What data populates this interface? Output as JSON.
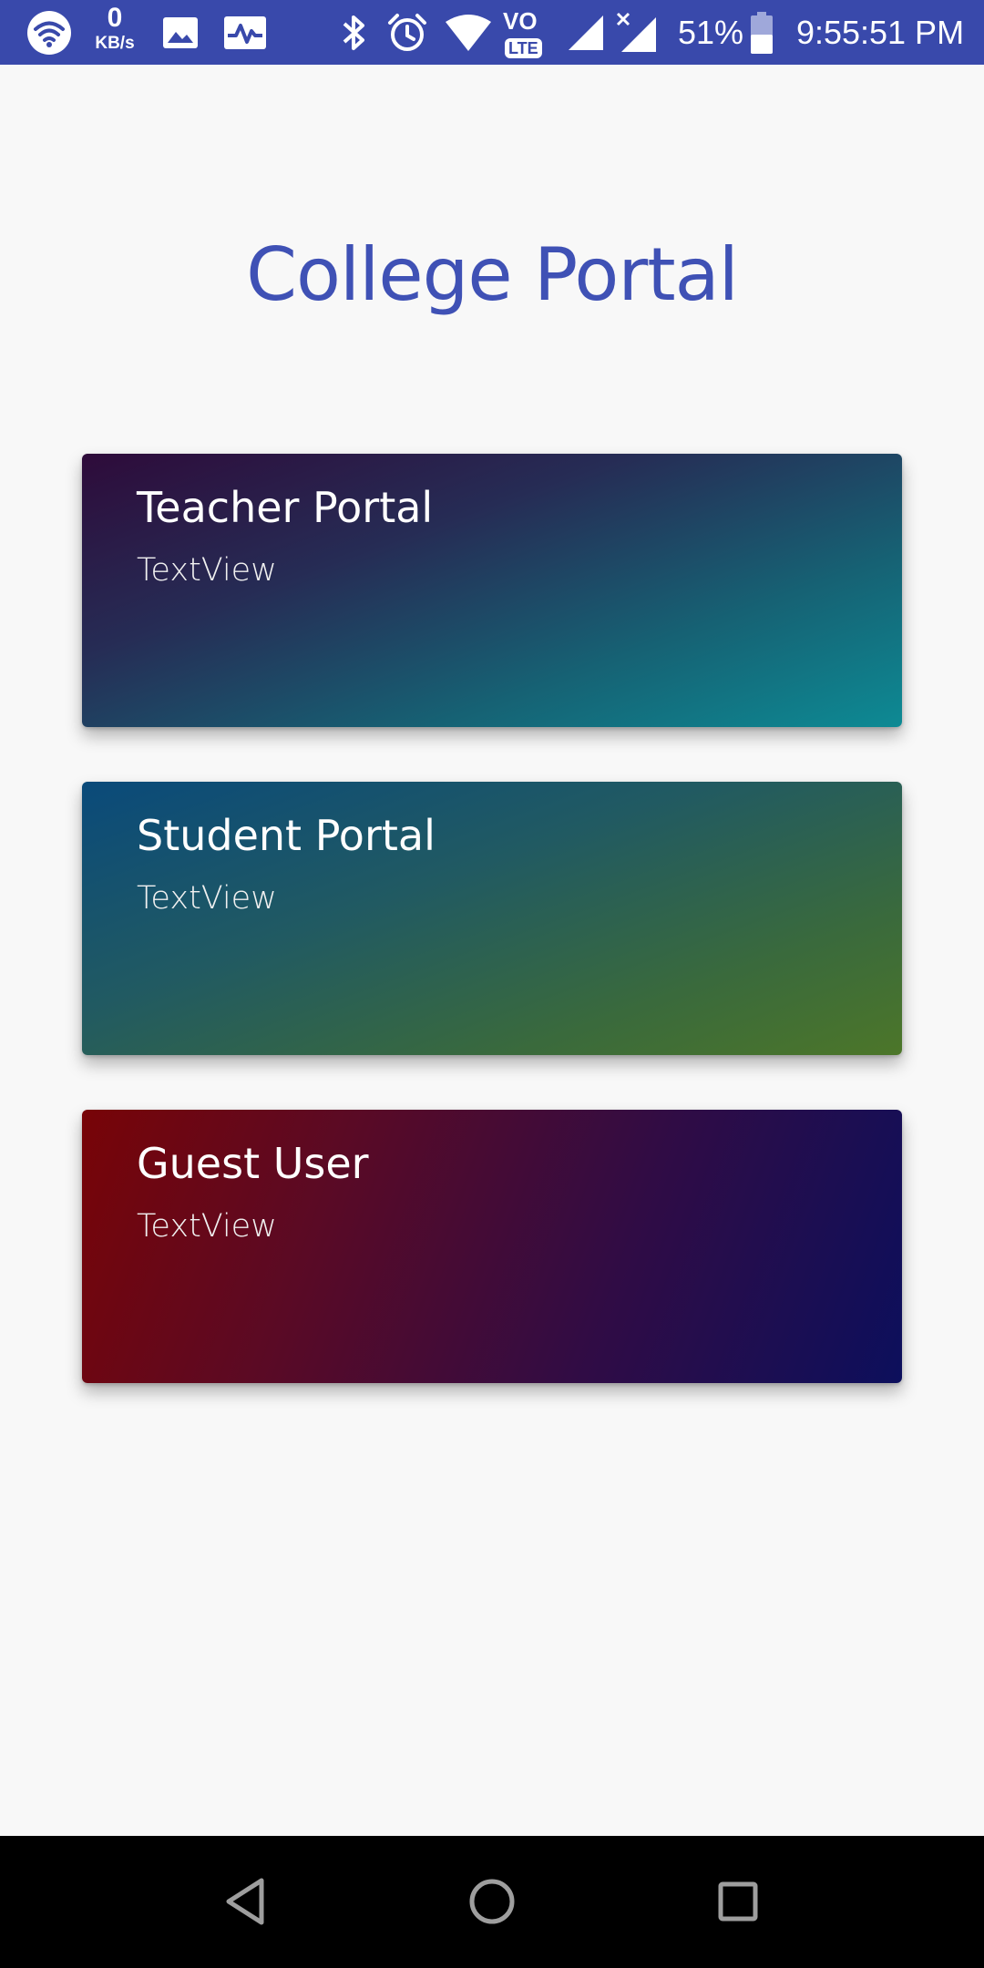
{
  "status_bar": {
    "speed_value": "0",
    "speed_unit": "KB/s",
    "battery": "51%",
    "time": "9:55:51 PM",
    "icons": [
      "wifi-icon",
      "image-icon",
      "activity-icon",
      "bluetooth-icon",
      "alarm-icon",
      "wifi-signal-icon",
      "volte-icon",
      "cell-signal-icon",
      "cell-signal-x-icon",
      "battery-icon"
    ],
    "volte_label": "VO",
    "lte_label": "LTE"
  },
  "page": {
    "title": "College Portal",
    "title_color": "#3f51b5"
  },
  "cards": [
    {
      "title": "Teacher Portal",
      "subtitle": "TextView"
    },
    {
      "title": "Student Portal",
      "subtitle": "TextView"
    },
    {
      "title": "Guest User",
      "subtitle": "TextView"
    }
  ],
  "nav_bar": {
    "icons": [
      "back-icon",
      "home-icon",
      "recents-icon"
    ]
  },
  "colors": {
    "status_bar": "#3949ab",
    "background": "#f8f8f8",
    "nav_bar": "#000000"
  }
}
